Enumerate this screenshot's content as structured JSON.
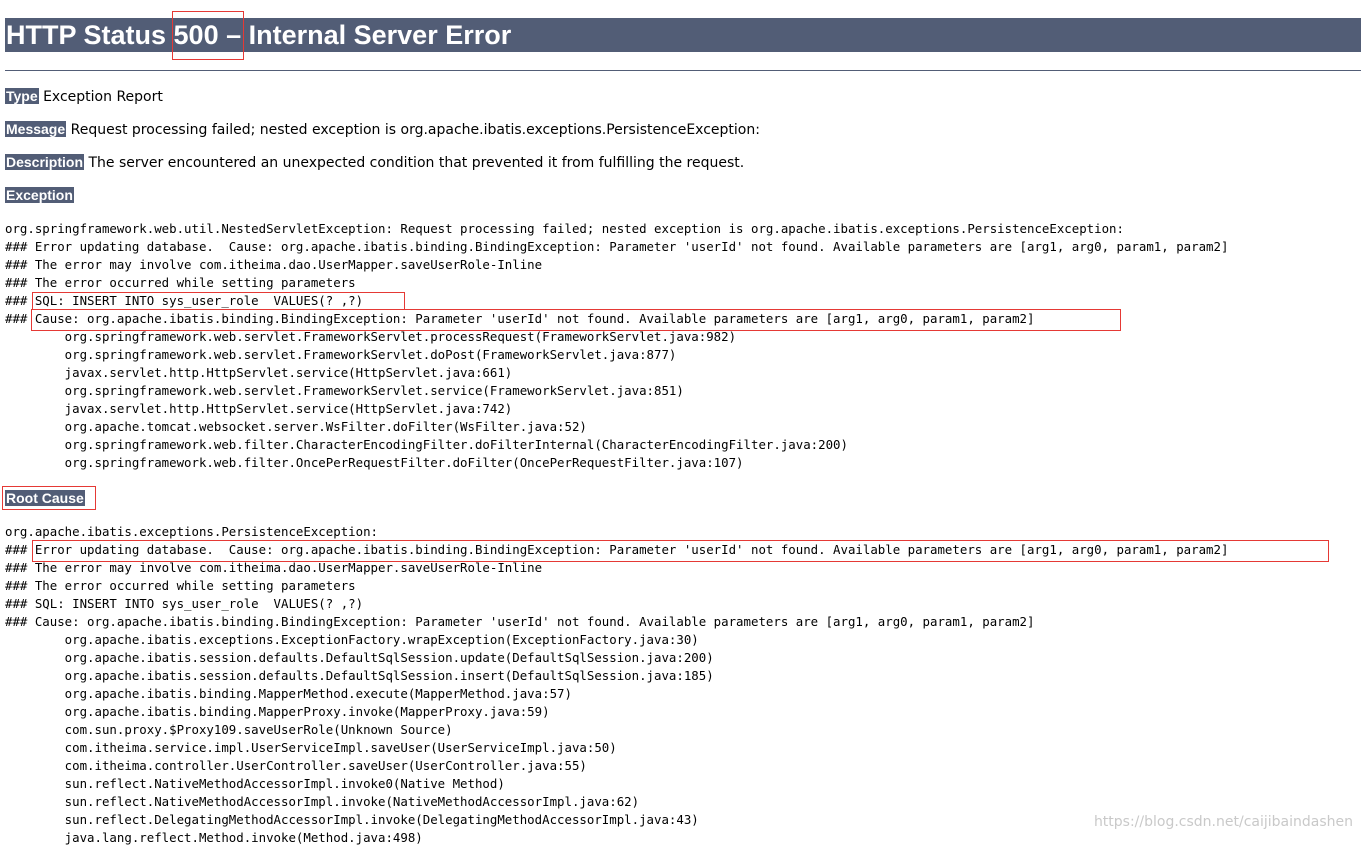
{
  "title": {
    "prefix": "HTTP Status ",
    "code": "500",
    "suffix": " – Internal Server Error"
  },
  "fields": [
    {
      "label": "Type",
      "value": " Exception Report"
    },
    {
      "label": "Message",
      "value": " Request processing failed; nested exception is org.apache.ibatis.exceptions.PersistenceException:"
    },
    {
      "label": "Description",
      "value": " The server encountered an unexpected condition that prevented it from fulfilling the request."
    }
  ],
  "exception": {
    "label": "Exception",
    "lines": [
      "org.springframework.web.util.NestedServletException: Request processing failed; nested exception is org.apache.ibatis.exceptions.PersistenceException:",
      "### Error updating database.  Cause: org.apache.ibatis.binding.BindingException: Parameter 'userId' not found. Available parameters are [arg1, arg0, param1, param2]",
      "### The error may involve com.itheima.dao.UserMapper.saveUserRole-Inline",
      "### The error occurred while setting parameters",
      "### SQL: INSERT INTO sys_user_role  VALUES(? ,?)",
      "### Cause: org.apache.ibatis.binding.BindingException: Parameter 'userId' not found. Available parameters are [arg1, arg0, param1, param2]",
      "\torg.springframework.web.servlet.FrameworkServlet.processRequest(FrameworkServlet.java:982)",
      "\torg.springframework.web.servlet.FrameworkServlet.doPost(FrameworkServlet.java:877)",
      "\tjavax.servlet.http.HttpServlet.service(HttpServlet.java:661)",
      "\torg.springframework.web.servlet.FrameworkServlet.service(FrameworkServlet.java:851)",
      "\tjavax.servlet.http.HttpServlet.service(HttpServlet.java:742)",
      "\torg.apache.tomcat.websocket.server.WsFilter.doFilter(WsFilter.java:52)",
      "\torg.springframework.web.filter.CharacterEncodingFilter.doFilterInternal(CharacterEncodingFilter.java:200)",
      "\torg.springframework.web.filter.OncePerRequestFilter.doFilter(OncePerRequestFilter.java:107)"
    ]
  },
  "root_cause": {
    "label": "Root Cause",
    "lines": [
      "org.apache.ibatis.exceptions.PersistenceException:",
      "### Error updating database.  Cause: org.apache.ibatis.binding.BindingException: Parameter 'userId' not found. Available parameters are [arg1, arg0, param1, param2]",
      "### The error may involve com.itheima.dao.UserMapper.saveUserRole-Inline",
      "### The error occurred while setting parameters",
      "### SQL: INSERT INTO sys_user_role  VALUES(? ,?)",
      "### Cause: org.apache.ibatis.binding.BindingException: Parameter 'userId' not found. Available parameters are [arg1, arg0, param1, param2]",
      "\torg.apache.ibatis.exceptions.ExceptionFactory.wrapException(ExceptionFactory.java:30)",
      "\torg.apache.ibatis.session.defaults.DefaultSqlSession.update(DefaultSqlSession.java:200)",
      "\torg.apache.ibatis.session.defaults.DefaultSqlSession.insert(DefaultSqlSession.java:185)",
      "\torg.apache.ibatis.binding.MapperMethod.execute(MapperMethod.java:57)",
      "\torg.apache.ibatis.binding.MapperProxy.invoke(MapperProxy.java:59)",
      "\tcom.sun.proxy.$Proxy109.saveUserRole(Unknown Source)",
      "\tcom.itheima.service.impl.UserServiceImpl.saveUser(UserServiceImpl.java:50)",
      "\tcom.itheima.controller.UserController.saveUser(UserController.java:55)",
      "\tsun.reflect.NativeMethodAccessorImpl.invoke0(Native Method)",
      "\tsun.reflect.NativeMethodAccessorImpl.invoke(NativeMethodAccessorImpl.java:62)",
      "\tsun.reflect.DelegatingMethodAccessorImpl.invoke(DelegatingMethodAccessorImpl.java:43)",
      "\tjava.lang.reflect.Method.invoke(Method.java:498)"
    ]
  },
  "watermark": "https://blog.csdn.net/caijibaindashen",
  "colors": {
    "header_bg": "#525d76",
    "header_text": "#ffffff",
    "highlight_border": "#e53935"
  }
}
